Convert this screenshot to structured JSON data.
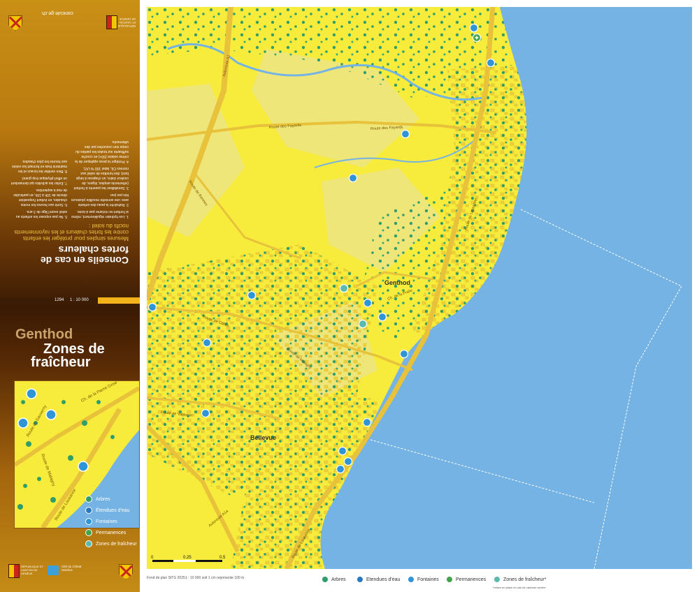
{
  "sidebar": {
    "website": "canicule.ge.ch",
    "header_logo_text": "RÉPUBLIQUE ET CANTON DE GENÈVE",
    "advice_title": "Conseils en cas de fortes chaleurs",
    "advice_subtitle": "Mesures simples pour protéger les enfants contre les fortes chaleurs et les rayonnements nocifs du soleil :",
    "advice_items": [
      "1. Les hydrater régulièrement, même si l'enfant ne réclame pas à boire.",
      "2. Rafraîchir la peau des enfants avec une serviette mouillée plusieurs fois par jour.",
      "3. Sensibiliser les parents à l'enfant (vêtements amples, légers, de couleur claire, un chapeau à large bord, des lunettes de soleil aux normes CE, label 100 % UV).",
      "4. Protéger la peau appliquer de la crème solaire (50+) en couche suffisante sur toutes les parties du corps non couvertes par des vêtements.",
      "5. Ne pas exposer les enfants au soleil avant l'âge de 3 ans.",
      "6. Sortir aux heures les moins chaudes, en évitant l'exposition directe de 10h à 16h, en particulier de mai à septembre.",
      "7. Éviter les activités qui demandent un effort physique trop grand.",
      "8. Bien ventiler les locaux et les maintenir frais en fermant les volets aux heures les plus chaudes."
    ],
    "map_number": "1294",
    "scale": "1 : 10 000",
    "town": "Genthod",
    "title_line1": "Zones de",
    "title_line2": "fraîcheur",
    "inset_streets": [
      "Ch. de la Pierre Grise",
      "Route de Sauverny",
      "Route de Malagny",
      "Route de Lausanne"
    ],
    "legend": [
      "Arbres",
      "Étendues d'eau",
      "Fontaines",
      "Permanences",
      "Zones de fraîcheur"
    ],
    "footer_logos": [
      "RÉPUBLIQUE ET CANTON DE GENÈVE",
      "Cité du Climat Genève"
    ]
  },
  "map": {
    "labels": {
      "genthod": "Genthod",
      "bellevue": "Bellevue"
    },
    "roads": [
      "Autoroute A1",
      "Route des Fayards",
      "Route de Lausanne",
      "Route des Fayards",
      "Route de Collex",
      "Route de Valavran",
      "Route de Malagny",
      "Ch. de la Pralie",
      "Route de Rennex",
      "Autoroute A1a",
      "Route de Lausanne"
    ],
    "scalebar": [
      "0",
      "0.25",
      "0.5"
    ],
    "colors": {
      "land": "#f7eb3c",
      "field": "#efe67a",
      "water": "#74b3e3",
      "tree": "#2f9e6a",
      "road": "#e8c23a"
    }
  },
  "footer": {
    "credit": "Fond de plan SITG 2025",
    "scale_note": "1 : 10 000 soit 1 cm représente 100 m",
    "legend": [
      "Arbres",
      "Etendues d'eau",
      "Fontaines",
      "Permanences",
      "Zones de fraîcheur*"
    ],
    "note": "*mises en place en cas de canicule sévère"
  }
}
